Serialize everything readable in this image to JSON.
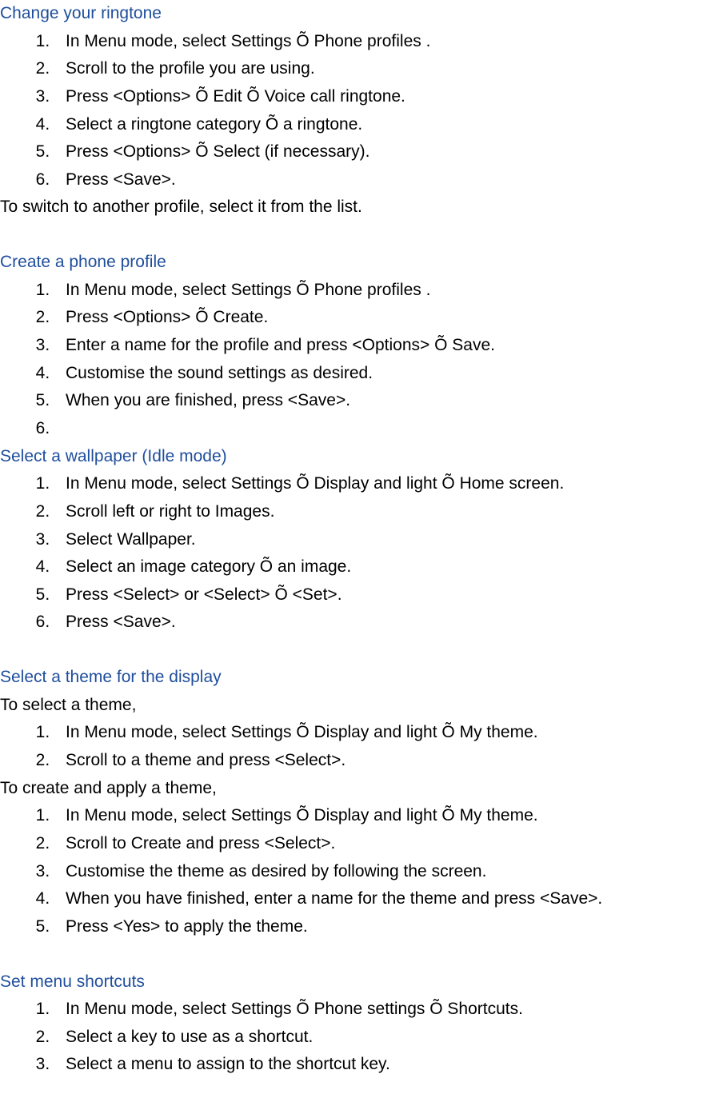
{
  "sections": {
    "changeRingtone": {
      "heading": "Change your ringtone",
      "items": [
        "In Menu mode, select Settings Õ Phone profiles .",
        "Scroll to the profile you are using.",
        "Press <Options> Õ Edit Õ Voice call ringtone.",
        "Select a ringtone category Õ a ringtone.",
        "Press <Options> Õ Select (if necessary).",
        "Press <Save>."
      ],
      "trailing": "To switch to another profile, select it from the list."
    },
    "createProfile": {
      "heading": "Create a phone profile",
      "items": [
        "In Menu mode, select Settings Õ Phone profiles .",
        "Press <Options> Õ Create.",
        "Enter a name for the profile and press <Options> Õ Save.",
        "Customise the sound settings as desired.",
        "When you are finished, press <Save>.",
        ""
      ]
    },
    "selectWallpaper": {
      "heading": "Select a wallpaper (Idle mode)",
      "items": [
        "In Menu mode, select Settings Õ Display and light Õ Home screen.",
        "Scroll left or right to Images.",
        "Select Wallpaper.",
        "Select an image category Õ an image.",
        "Press <Select> or <Select> Õ <Set>.",
        "Press <Save>."
      ]
    },
    "selectTheme": {
      "heading": "Select a theme for the display",
      "intro1": "To select a theme,",
      "items1": [
        "In Menu mode, select Settings Õ Display and light Õ My theme.",
        "Scroll to a theme and press <Select>."
      ],
      "intro2": "To create and apply a theme,",
      "items2": [
        "In Menu mode, select Settings Õ Display and light Õ My theme.",
        "Scroll to Create and press <Select>.",
        "Customise the theme as desired by following the screen.",
        "When you have finished, enter a name for the theme and press <Save>.",
        "Press <Yes> to apply the theme."
      ]
    },
    "setShortcuts": {
      "heading": "Set menu shortcuts",
      "items": [
        "In Menu mode, select Settings Õ Phone settings Õ Shortcuts.",
        "Select a key to use as a shortcut.",
        "Select a menu to assign to the shortcut key."
      ]
    }
  }
}
